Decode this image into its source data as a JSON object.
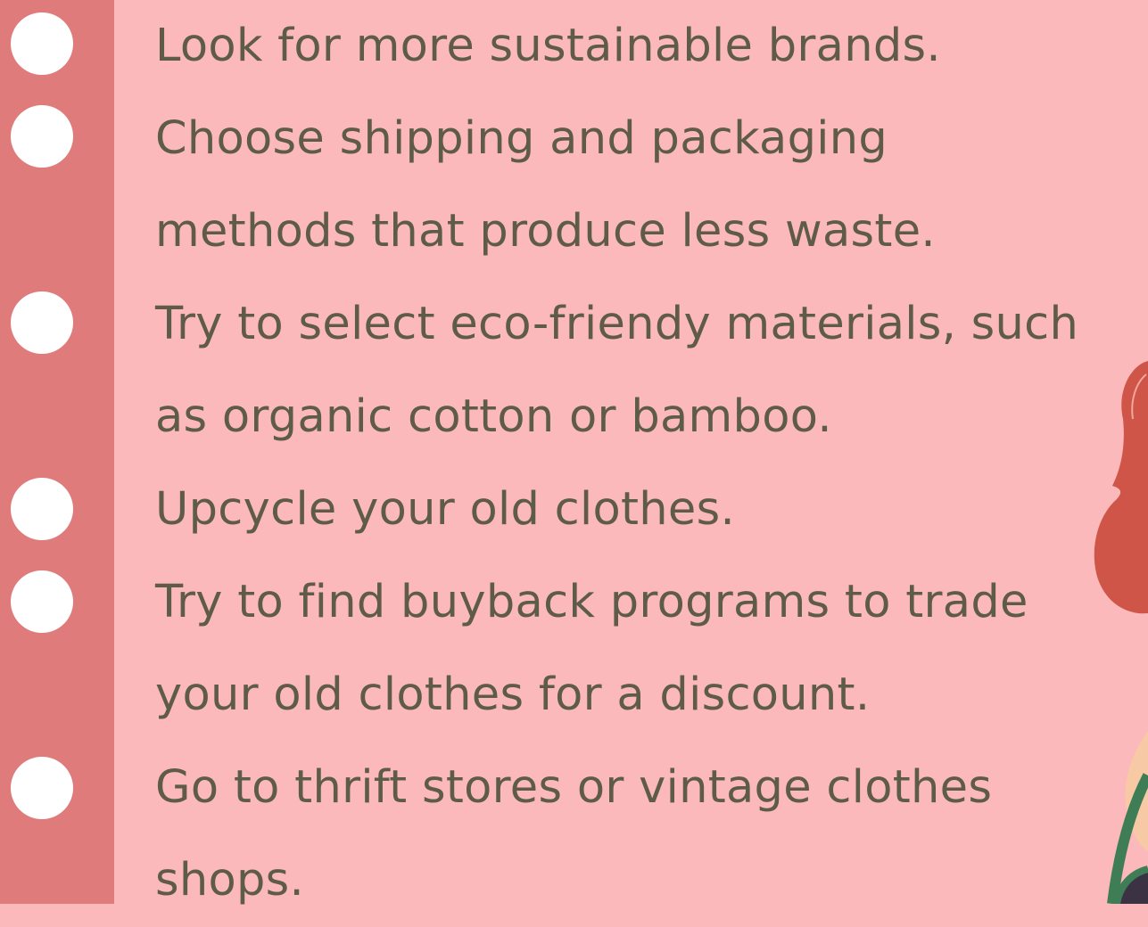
{
  "tips": {
    "line1": "Look for more sustainable brands.",
    "line2": "Choose shipping and packaging",
    "line3": "methods that produce less waste.",
    "line4": "Try to select eco-friendy materials, such",
    "line5": "as organic cotton or bamboo.",
    "line6": "Upcycle your old clothes.",
    "line7": "Try to find buyback programs to trade",
    "line8": "your old clothes for a discount.",
    "line9": "Go to thrift stores or vintage clothes",
    "line10": "shops."
  },
  "colors": {
    "background": "#fcb9bb",
    "left_strip": "#e07b7c",
    "bullet": "#ffffff",
    "text": "#5e5b4b"
  }
}
